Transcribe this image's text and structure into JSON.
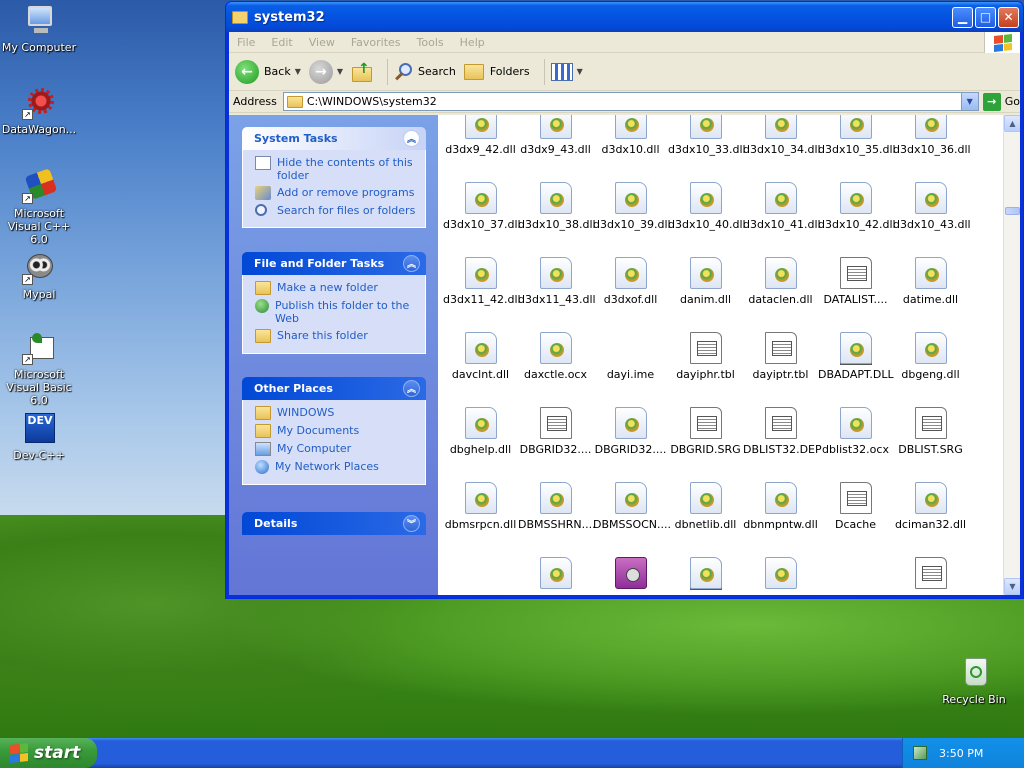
{
  "desktop": {
    "icons": [
      {
        "label": "My Computer"
      },
      {
        "label": "DataWagon..."
      },
      {
        "label": "Microsoft Visual C++ 6.0"
      },
      {
        "label": "Mypal"
      },
      {
        "label": "Microsoft Visual Basic 6.0"
      },
      {
        "label": "Dev-C++"
      },
      {
        "label": "Recycle Bin"
      }
    ],
    "dev_badge": "DEV"
  },
  "window": {
    "title": "system32",
    "menu": [
      "File",
      "Edit",
      "View",
      "Favorites",
      "Tools",
      "Help"
    ],
    "toolbar": {
      "back": "Back",
      "search": "Search",
      "folders": "Folders"
    },
    "address": {
      "label": "Address",
      "path": "C:\\WINDOWS\\system32",
      "go": "Go"
    }
  },
  "tasks": {
    "system": {
      "title": "System Tasks",
      "items": [
        "Hide the contents of this folder",
        "Add or remove programs",
        "Search for files or folders"
      ]
    },
    "file_folder": {
      "title": "File and Folder Tasks",
      "items": [
        "Make a new folder",
        "Publish this folder to the Web",
        "Share this folder"
      ]
    },
    "other_places": {
      "title": "Other Places",
      "items": [
        "WINDOWS",
        "My Documents",
        "My Computer",
        "My Network Places"
      ]
    },
    "details": {
      "title": "Details"
    }
  },
  "files": [
    {
      "name": "d3dx9_42.dll",
      "type": "dll"
    },
    {
      "name": "d3dx9_43.dll",
      "type": "dll"
    },
    {
      "name": "d3dx10.dll",
      "type": "dll"
    },
    {
      "name": "d3dx10_33.dll",
      "type": "dll"
    },
    {
      "name": "d3dx10_34.dll",
      "type": "dll"
    },
    {
      "name": "d3dx10_35.dll",
      "type": "dll"
    },
    {
      "name": "d3dx10_36.dll",
      "type": "dll"
    },
    {
      "name": "d3dx10_37.dll",
      "type": "dll"
    },
    {
      "name": "d3dx10_38.dll",
      "type": "dll"
    },
    {
      "name": "d3dx10_39.dll",
      "type": "dll"
    },
    {
      "name": "d3dx10_40.dll",
      "type": "dll"
    },
    {
      "name": "d3dx10_41.dll",
      "type": "dll"
    },
    {
      "name": "d3dx10_42.dll",
      "type": "dll"
    },
    {
      "name": "d3dx10_43.dll",
      "type": "dll"
    },
    {
      "name": "d3dx11_42.dll",
      "type": "dll"
    },
    {
      "name": "d3dx11_43.dll",
      "type": "dll"
    },
    {
      "name": "d3dxof.dll",
      "type": "dll"
    },
    {
      "name": "danim.dll",
      "type": "dll"
    },
    {
      "name": "dataclen.dll",
      "type": "dll"
    },
    {
      "name": "DATALIST....",
      "type": "doc"
    },
    {
      "name": "datime.dll",
      "type": "dll"
    },
    {
      "name": "davclnt.dll",
      "type": "dll"
    },
    {
      "name": "daxctle.ocx",
      "type": "dll"
    },
    {
      "name": "dayi.ime",
      "type": "win"
    },
    {
      "name": "dayiphr.tbl",
      "type": "doc"
    },
    {
      "name": "dayiptr.tbl",
      "type": "doc"
    },
    {
      "name": "DBADAPT.DLL",
      "type": "dll"
    },
    {
      "name": "dbgeng.dll",
      "type": "dll"
    },
    {
      "name": "dbghelp.dll",
      "type": "dll"
    },
    {
      "name": "DBGRID32....",
      "type": "doc"
    },
    {
      "name": "DBGRID32....",
      "type": "dll"
    },
    {
      "name": "DBGRID.SRG",
      "type": "doc"
    },
    {
      "name": "DBLIST32.DEP",
      "type": "doc"
    },
    {
      "name": "dblist32.ocx",
      "type": "dll"
    },
    {
      "name": "DBLIST.SRG",
      "type": "doc"
    },
    {
      "name": "dbmsrpcn.dll",
      "type": "dll"
    },
    {
      "name": "DBMSSHRN....",
      "type": "dll"
    },
    {
      "name": "DBMSSOCN....",
      "type": "dll"
    },
    {
      "name": "dbnetlib.dll",
      "type": "dll"
    },
    {
      "name": "dbnmpntw.dll",
      "type": "dll"
    },
    {
      "name": "Dcache",
      "type": "doc"
    },
    {
      "name": "dciman32.dll",
      "type": "dll"
    },
    {
      "name": "",
      "type": "win"
    },
    {
      "name": "",
      "type": "dll"
    },
    {
      "name": "",
      "type": "safe"
    },
    {
      "name": "",
      "type": "dll"
    },
    {
      "name": "",
      "type": "dll"
    },
    {
      "name": "",
      "type": "win"
    },
    {
      "name": "",
      "type": "doc"
    }
  ],
  "taskbar": {
    "start": "start",
    "clock": "3:50 PM"
  },
  "colors": {
    "taskbar": "#245edb",
    "start": "#3b9c3b",
    "titlebar": "#0453e0",
    "link": "#215dc6"
  }
}
